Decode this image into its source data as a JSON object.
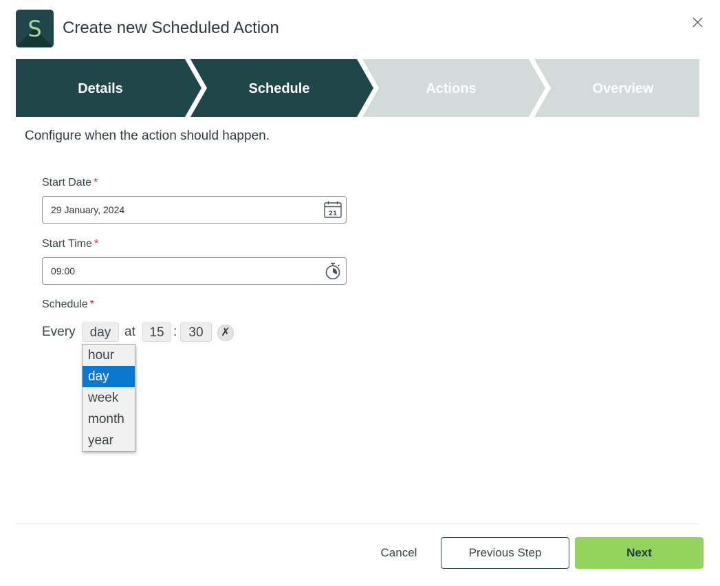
{
  "header": {
    "logo_letter": "S",
    "title": "Create new Scheduled Action",
    "close_icon": "close-icon"
  },
  "stepper": {
    "steps": [
      {
        "label": "Details",
        "state": "complete"
      },
      {
        "label": "Schedule",
        "state": "active"
      },
      {
        "label": "Actions",
        "state": "inactive"
      },
      {
        "label": "Overview",
        "state": "inactive"
      }
    ],
    "colors": {
      "active": "#1f4649",
      "inactive": "#d3dbda"
    }
  },
  "intro": "Configure when the action should happen.",
  "form": {
    "start_date": {
      "label": "Start Date",
      "required_mark": "*",
      "value": "29 January, 2024",
      "icon": "calendar-icon",
      "icon_text": "21"
    },
    "start_time": {
      "label": "Start Time",
      "required_mark": "*",
      "value": "09:00",
      "icon": "stopwatch-icon"
    },
    "schedule": {
      "label": "Schedule",
      "required_mark": "*",
      "every_label": "Every",
      "period_value": "day",
      "at_label": "at",
      "hour": "15",
      "separator": ":",
      "minute": "30",
      "clear_label": "✗",
      "period_options": [
        "hour",
        "day",
        "week",
        "month",
        "year"
      ],
      "selected_option": "day"
    }
  },
  "footer": {
    "cancel_label": "Cancel",
    "previous_label": "Previous Step",
    "next_label": "Next",
    "next_color": "#93d35e"
  }
}
